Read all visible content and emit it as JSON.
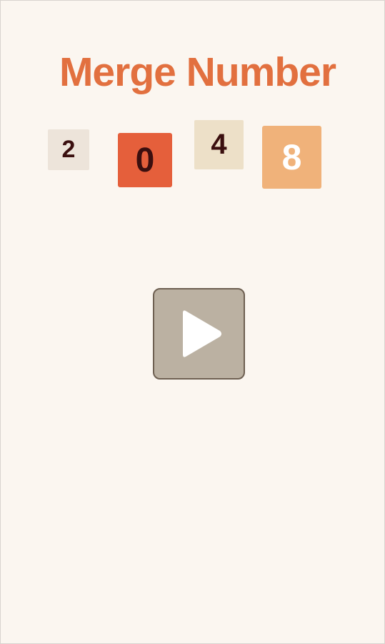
{
  "title": {
    "text": "Merge Number",
    "color": "#e2703f"
  },
  "tiles": [
    {
      "value": "2",
      "bg": "#ede4da",
      "fg": "#3b0f0f"
    },
    {
      "value": "0",
      "bg": "#e55f3b",
      "fg": "#3b0f0f"
    },
    {
      "value": "4",
      "bg": "#ede0c8",
      "fg": "#3b0f0f"
    },
    {
      "value": "8",
      "bg": "#f0b27a",
      "fg": "#ffffff"
    }
  ],
  "play_button": {
    "icon": "play-icon",
    "bg": "#bbb1a2",
    "border": "#6e6052",
    "icon_color": "#ffffff"
  },
  "background": "#fbf6f0"
}
